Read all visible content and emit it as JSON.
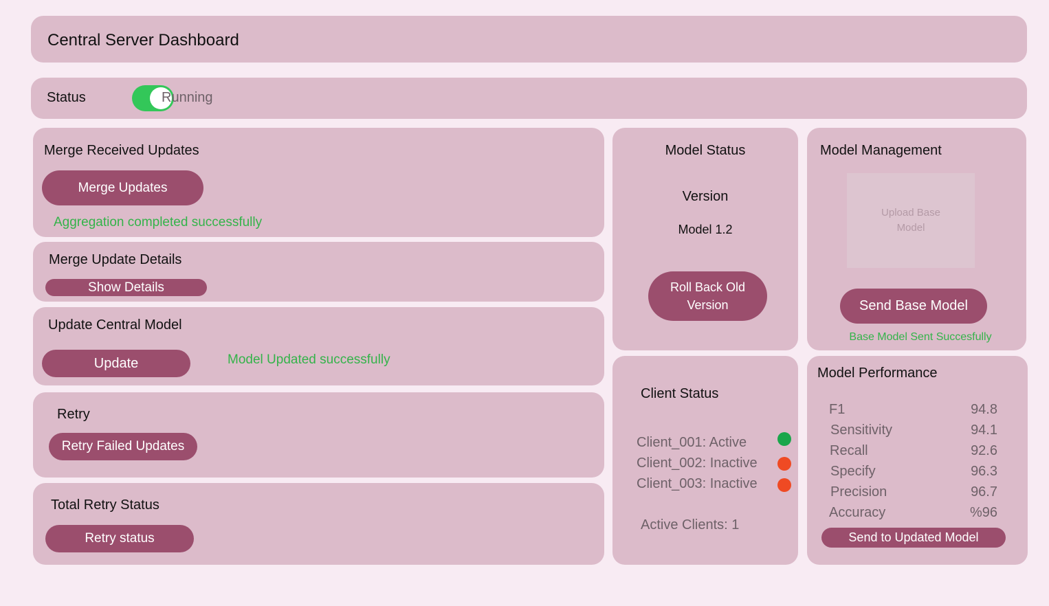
{
  "header": {
    "title": "Central Server Dashboard"
  },
  "status_bar": {
    "label": "Status",
    "toggle_on": true,
    "state": "Running"
  },
  "merge_received": {
    "title": "Merge Received Updates",
    "button": "Merge Updates",
    "message": "Aggregation completed successfully"
  },
  "merge_details": {
    "title": "Merge Update Details",
    "button": "Show Details"
  },
  "update_central": {
    "title": "Update Central Model",
    "button": "Update",
    "message": "Model Updated successfully"
  },
  "retry": {
    "title": "Retry",
    "button": "Retry Failed Updates"
  },
  "total_retry": {
    "title": "Total Retry Status",
    "button": "Retry status"
  },
  "model_status": {
    "title": "Model Status",
    "version_label": "Version",
    "version_value": "Model 1.2",
    "button_line1": "Roll Back Old",
    "button_line2": "Version"
  },
  "model_management": {
    "title": "Model Management",
    "upload_line1": "Upload Base",
    "upload_line2": "Model",
    "button": "Send Base Model",
    "message": "Base Model Sent Succesfully"
  },
  "client_status": {
    "title": "Client Status",
    "clients": [
      {
        "label": "Client_001: Active",
        "color": "#1aa64b"
      },
      {
        "label": "Client_002: Inactive",
        "color": "#ef4a23"
      },
      {
        "label": "Client_003: Inactive",
        "color": "#ef4a23"
      }
    ],
    "active_count": "Active Clients: 1"
  },
  "model_performance": {
    "title": "Model Performance",
    "metrics": [
      {
        "name": "F1",
        "value": "94.8"
      },
      {
        "name": "Sensitivity",
        "value": "94.1"
      },
      {
        "name": "Recall",
        "value": "92.6"
      },
      {
        "name": "Specify",
        "value": "96.3"
      },
      {
        "name": "Precision",
        "value": "96.7"
      },
      {
        "name": "Accuracy",
        "value": "%96"
      }
    ],
    "button": "Send to Updated Model"
  },
  "colors": {
    "background": "#f8ebf3",
    "card": "#dcbbca",
    "button": "#9b4e6d",
    "success": "#34b34a",
    "toggle_on": "#33c759"
  }
}
